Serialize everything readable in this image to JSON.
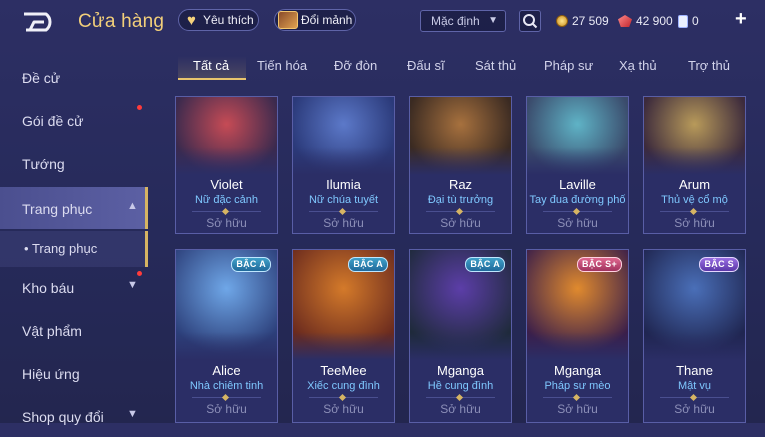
{
  "header": {
    "title": "Cửa hàng",
    "favorites_label": "Yêu thích",
    "exchange_label": "Đổi mảnh",
    "sort_value": "Mặc định",
    "gold": "27 509",
    "gems": "42 900",
    "vouchers": "0"
  },
  "sidebar": {
    "items": [
      {
        "label": "Đề cử"
      },
      {
        "label": "Gói đề cử"
      },
      {
        "label": "Tướng"
      },
      {
        "label": "Trang phục"
      },
      {
        "label": "Trang phục"
      },
      {
        "label": "Kho báu"
      },
      {
        "label": "Vật phẩm"
      },
      {
        "label": "Hiệu ứng"
      },
      {
        "label": "Shop quy đổi"
      }
    ]
  },
  "tabs": [
    "Tất cả",
    "Tiến hóa",
    "Đỡ đòn",
    "Đấu sĩ",
    "Sát thủ",
    "Pháp sư",
    "Xạ thủ",
    "Trợ thủ"
  ],
  "cards": [
    {
      "name": "Violet",
      "skin": "Nữ đặc cảnh",
      "status": "Sở hữu",
      "badge": "",
      "colors": [
        "#c64b55",
        "#3b2a4e"
      ]
    },
    {
      "name": "Ilumia",
      "skin": "Nữ chúa tuyết",
      "status": "Sở hữu",
      "badge": "",
      "colors": [
        "#5c79c9",
        "#2b3a7a"
      ]
    },
    {
      "name": "Raz",
      "skin": "Đại tù trưởng",
      "status": "Sở hữu",
      "badge": "",
      "colors": [
        "#a7713e",
        "#3a2a22"
      ]
    },
    {
      "name": "Laville",
      "skin": "Tay đua đường phố",
      "status": "Sở hữu",
      "badge": "",
      "colors": [
        "#5fb3c6",
        "#3a4a6b"
      ]
    },
    {
      "name": "Arum",
      "skin": "Thủ vệ cổ mộ",
      "status": "Sở hữu",
      "badge": "",
      "colors": [
        "#b89a5a",
        "#3c2a3c"
      ]
    },
    {
      "name": "Alice",
      "skin": "Nhà chiêm tinh",
      "status": "Sở hữu",
      "badge": "BẬC A",
      "colors": [
        "#6fa7e8",
        "#2c3f7a"
      ]
    },
    {
      "name": "TeeMee",
      "skin": "Xiếc cung đình",
      "status": "Sở hữu",
      "badge": "BẬC A",
      "colors": [
        "#d47a2a",
        "#6a2a1e"
      ]
    },
    {
      "name": "Mganga",
      "skin": "Hề cung đình",
      "status": "Sở hữu",
      "badge": "BẬC A",
      "colors": [
        "#5c3ea8",
        "#1e2a3a"
      ]
    },
    {
      "name": "Mganga",
      "skin": "Pháp sư mèo",
      "status": "Sở hữu",
      "badge": "BẬC S+",
      "colors": [
        "#e08a2e",
        "#3a1e4a"
      ]
    },
    {
      "name": "Thane",
      "skin": "Mật vụ",
      "status": "Sở hữu",
      "badge": "BẬC S",
      "colors": [
        "#4a6fb8",
        "#1f2550"
      ]
    }
  ],
  "colors": {
    "title_gold": "#f2cf7a",
    "skin_blue": "#7fc8ff",
    "notification_red": "#ff3b3b",
    "active_tab_underline": "#e9c56d"
  },
  "icons": [
    "back-icon",
    "heart-icon",
    "fragment-icon",
    "chevron-down-icon",
    "search-icon",
    "gold-coin-icon",
    "ruby-icon",
    "voucher-icon",
    "plus-icon"
  ]
}
